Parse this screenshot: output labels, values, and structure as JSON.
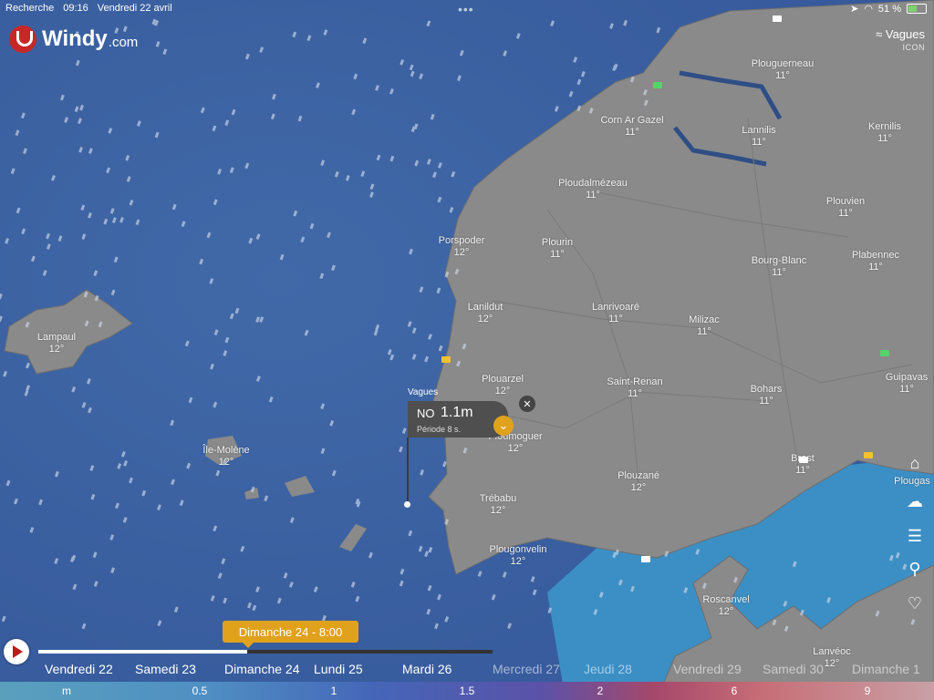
{
  "status": {
    "back_label": "Recherche",
    "time": "09:16",
    "date": "Vendredi 22 avril",
    "battery": "51 %"
  },
  "brand": {
    "name": "Windy",
    "domain": ".com"
  },
  "layer": {
    "label": "Vagues",
    "model": "ICON"
  },
  "cities": [
    {
      "name": "Plouguerneau",
      "temp": "11°"
    },
    {
      "name": "Corn Ar Gazel",
      "temp": "11°"
    },
    {
      "name": "Lannilis",
      "temp": "11°"
    },
    {
      "name": "Kernilis",
      "temp": "11°"
    },
    {
      "name": "Ploudalmézeau",
      "temp": "11°"
    },
    {
      "name": "Plouvien",
      "temp": "11°"
    },
    {
      "name": "Porspoder",
      "temp": "12°"
    },
    {
      "name": "Plourin",
      "temp": "11°"
    },
    {
      "name": "Bourg-Blanc",
      "temp": "11°"
    },
    {
      "name": "Plabennec",
      "temp": "11°"
    },
    {
      "name": "Lanildut",
      "temp": "12°"
    },
    {
      "name": "Lanrivoaré",
      "temp": "11°"
    },
    {
      "name": "Milizac",
      "temp": "11°"
    },
    {
      "name": "Lampaul",
      "temp": "12°"
    },
    {
      "name": "Plouarzel",
      "temp": "12°"
    },
    {
      "name": "Saint-Renan",
      "temp": "11°"
    },
    {
      "name": "Bohars",
      "temp": "11°"
    },
    {
      "name": "Guipavas",
      "temp": "11°"
    },
    {
      "name": "Ploumoguer",
      "temp": "12°"
    },
    {
      "name": "Île-Molène",
      "temp": "12°"
    },
    {
      "name": "Brest",
      "temp": "11°"
    },
    {
      "name": "Plougas",
      "temp": ""
    },
    {
      "name": "Plouzané",
      "temp": "12°"
    },
    {
      "name": "Trébabu",
      "temp": "12°"
    },
    {
      "name": "Plougonvelin",
      "temp": "12°"
    },
    {
      "name": "Roscanvel",
      "temp": "12°"
    },
    {
      "name": "Lanvéoc",
      "temp": "12°"
    }
  ],
  "popup": {
    "title": "Vagues",
    "direction": "NO",
    "height": "1.1m",
    "period": "Période 8 s."
  },
  "timeline": {
    "current": "Dimanche 24 - 8:00",
    "progress": 0.46,
    "days": [
      {
        "label": "Vendredi 22"
      },
      {
        "label": "Samedi 23"
      },
      {
        "label": "Dimanche 24"
      },
      {
        "label": "Lundi 25"
      },
      {
        "label": "Mardi 26"
      },
      {
        "label": "Mercredi 27"
      },
      {
        "label": "Jeudi 28"
      },
      {
        "label": "Vendredi 29"
      },
      {
        "label": "Samedi 30"
      },
      {
        "label": "Dimanche 1"
      }
    ]
  },
  "scale": {
    "unit": "m",
    "ticks": [
      "0.5",
      "1",
      "1.5",
      "2",
      "6",
      "9"
    ]
  },
  "colors": {
    "ocean": "#3d5f9c",
    "land": "#8a8a8a",
    "accent": "#e0a21c",
    "popup": "#4f4f4f"
  }
}
